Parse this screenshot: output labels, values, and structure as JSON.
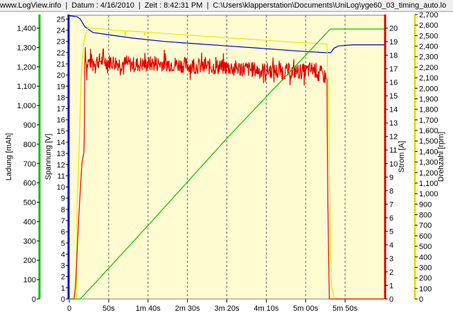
{
  "header": {
    "site": "www.LogView.info",
    "date": "Datum : 4/16/2010",
    "time": "Zeit : 8:42:31 PM",
    "path": "C:\\Users\\klapperstation\\Documents\\UniLog\\yge60_03_timing_auto.lo"
  },
  "chart_data": {
    "type": "line",
    "x_label": "",
    "x_ticks": [
      "0",
      "50s",
      "1m 40s",
      "2m 30s",
      "3m 20s",
      "4m 10s",
      "5m 00s",
      "5m 50s"
    ],
    "x_range": [
      0,
      400
    ],
    "axes": [
      {
        "id": "ladung",
        "label": "Ladung [mAh]",
        "color": "#00c000",
        "side": "left",
        "range": [
          0,
          1470
        ],
        "ticks": [
          "0",
          "100",
          "200",
          "300",
          "400",
          "500",
          "600",
          "700",
          "800",
          "900",
          "1,000",
          "1,100",
          "1,200",
          "1,300",
          "1,400"
        ]
      },
      {
        "id": "spannung",
        "label": "Spannung [V]",
        "color": "#0000d0",
        "side": "left",
        "range": [
          0,
          25.4
        ],
        "ticks": [
          "0",
          "1",
          "2",
          "3",
          "4",
          "5",
          "6",
          "7",
          "8",
          "9",
          "10",
          "11",
          "12",
          "13",
          "14",
          "15",
          "16",
          "17",
          "18",
          "19",
          "20",
          "21",
          "22",
          "23",
          "24",
          "25"
        ]
      },
      {
        "id": "strom",
        "label": "Strom [A]",
        "color": "#e00000",
        "side": "right",
        "range": [
          0,
          21
        ],
        "ticks": [
          "0",
          "1",
          "2",
          "3",
          "4",
          "5",
          "6",
          "7",
          "8",
          "9",
          "10",
          "11",
          "12",
          "13",
          "14",
          "15",
          "16",
          "17",
          "18",
          "19",
          "20"
        ]
      },
      {
        "id": "drehzahl",
        "label": "Drehzahl [rpm]",
        "color": "#e0e000",
        "side": "right",
        "range": [
          0,
          2700
        ],
        "ticks": [
          "0",
          "100",
          "200",
          "300",
          "400",
          "500",
          "600",
          "700",
          "800",
          "900",
          "1,000",
          "1,100",
          "1,200",
          "1,300",
          "1,400",
          "1,500",
          "1,600",
          "1,700",
          "1,800",
          "1,900",
          "2,000",
          "2,100",
          "2,200",
          "2,300",
          "2,400",
          "2,500",
          "2,600",
          "2,700"
        ]
      }
    ],
    "series": [
      {
        "axis": "spannung",
        "color": "#0000c0",
        "points": [
          [
            0,
            25.3
          ],
          [
            10,
            25.2
          ],
          [
            14,
            25.0
          ],
          [
            20,
            24.3
          ],
          [
            30,
            23.8
          ],
          [
            50,
            23.6
          ],
          [
            80,
            23.3
          ],
          [
            120,
            23.0
          ],
          [
            160,
            22.8
          ],
          [
            200,
            22.6
          ],
          [
            240,
            22.4
          ],
          [
            280,
            22.2
          ],
          [
            300,
            22.1
          ],
          [
            325,
            22.0
          ],
          [
            332,
            22.0
          ],
          [
            336,
            22.4
          ],
          [
            342,
            22.6
          ],
          [
            360,
            22.7
          ],
          [
            400,
            22.7
          ]
        ]
      },
      {
        "axis": "drehzahl",
        "color": "#e8e800",
        "points": [
          [
            0,
            0
          ],
          [
            5,
            0
          ],
          [
            9,
            0
          ],
          [
            10,
            900
          ],
          [
            12,
            1300
          ],
          [
            15,
            2100
          ],
          [
            18,
            2400
          ],
          [
            20,
            2500
          ],
          [
            24,
            2580
          ],
          [
            30,
            2570
          ],
          [
            60,
            2550
          ],
          [
            70,
            2545
          ],
          [
            71,
            2500
          ],
          [
            72,
            2545
          ],
          [
            95,
            2535
          ],
          [
            96,
            2500
          ],
          [
            97,
            2535
          ],
          [
            120,
            2520
          ],
          [
            160,
            2500
          ],
          [
            200,
            2480
          ],
          [
            240,
            2460
          ],
          [
            280,
            2440
          ],
          [
            305,
            2430
          ],
          [
            320,
            2425
          ],
          [
            327,
            2420
          ],
          [
            329,
            1900
          ],
          [
            331,
            600
          ],
          [
            333,
            120
          ],
          [
            336,
            20
          ],
          [
            340,
            0
          ],
          [
            400,
            0
          ]
        ]
      },
      {
        "axis": "strom",
        "color": "#e00000",
        "points": [
          [
            0,
            0
          ],
          [
            6,
            0
          ],
          [
            8,
            1
          ],
          [
            12,
            6
          ],
          [
            16,
            10
          ],
          [
            19,
            11
          ],
          [
            20,
            19
          ],
          [
            22,
            17
          ],
          [
            24,
            17.5
          ],
          [
            40,
            17.6
          ],
          [
            80,
            17.3
          ],
          [
            120,
            17.4
          ],
          [
            160,
            17.2
          ],
          [
            200,
            17.1
          ],
          [
            240,
            16.9
          ],
          [
            280,
            16.8
          ],
          [
            300,
            16.8
          ],
          [
            310,
            17.0
          ],
          [
            320,
            16.6
          ],
          [
            325,
            16.4
          ],
          [
            327,
            16.2
          ],
          [
            328,
            8
          ],
          [
            330,
            0
          ],
          [
            400,
            0
          ]
        ],
        "noise_amplitude": 0.6,
        "noise_range": [
          20,
          326
        ]
      },
      {
        "axis": "ladung",
        "color": "#00c000",
        "points": [
          [
            0,
            0
          ],
          [
            14,
            0
          ],
          [
            30,
            70
          ],
          [
            100,
            380
          ],
          [
            200,
            830
          ],
          [
            300,
            1260
          ],
          [
            330,
            1390
          ],
          [
            332,
            1395
          ],
          [
            400,
            1395
          ]
        ]
      }
    ]
  }
}
